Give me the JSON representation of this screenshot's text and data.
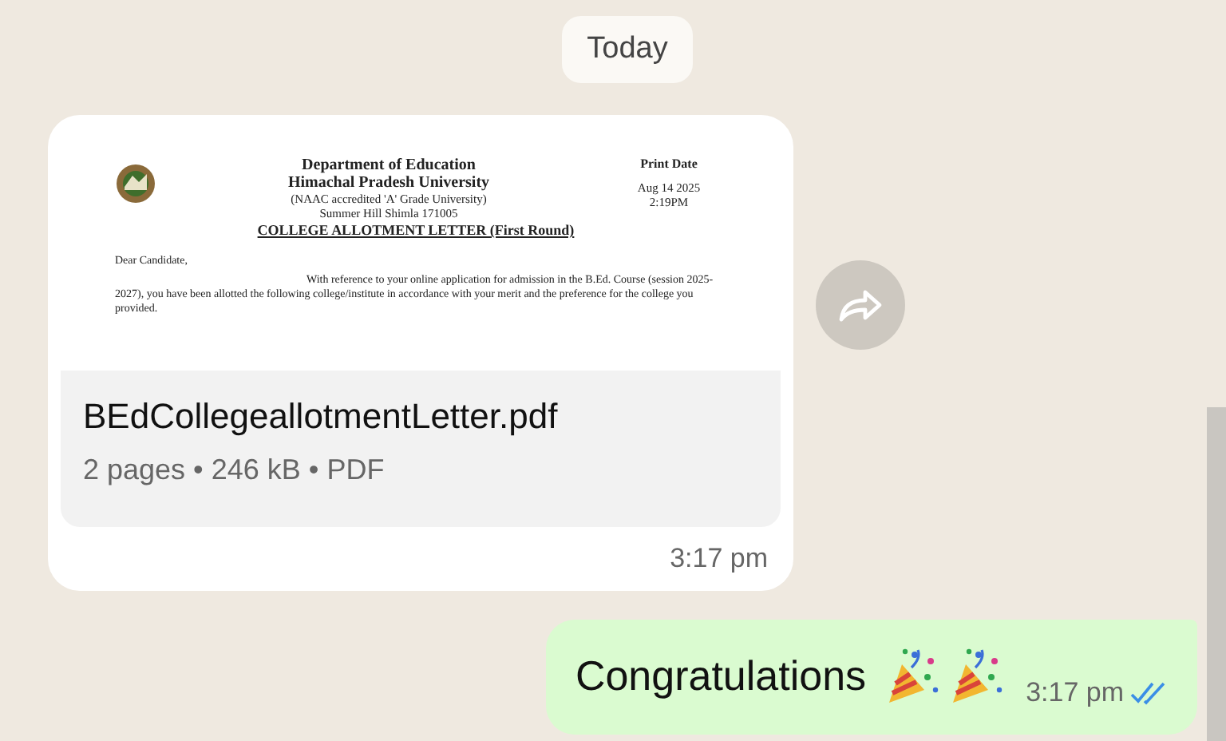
{
  "date_chip": "Today",
  "incoming": {
    "document": {
      "header_title": "Department of Education",
      "header_university": "Himachal Pradesh University",
      "header_accreditation": "(NAAC accredited 'A' Grade University)",
      "header_address": "Summer Hill Shimla 171005",
      "print_date_label": "Print Date",
      "print_date": "Aug 14 2025",
      "print_time": "2:19PM",
      "letter_title": "COLLEGE ALLOTMENT LETTER (First Round)",
      "salutation": "Dear Candidate,",
      "body": "With reference to your online application for admission in the B.Ed. Course (session 2025-2027), you have been allotted the following college/institute in accordance with your merit and the preference for the college you provided."
    },
    "file_name": "BEdCollegeallotmentLetter.pdf",
    "file_meta": "2 pages • 246 kB • PDF",
    "time": "3:17 pm"
  },
  "outgoing": {
    "text": "Congratulations",
    "emojis": [
      {
        "kind": "party_popper"
      },
      {
        "kind": "party_popper"
      }
    ],
    "time": "3:17 pm",
    "read": true
  }
}
